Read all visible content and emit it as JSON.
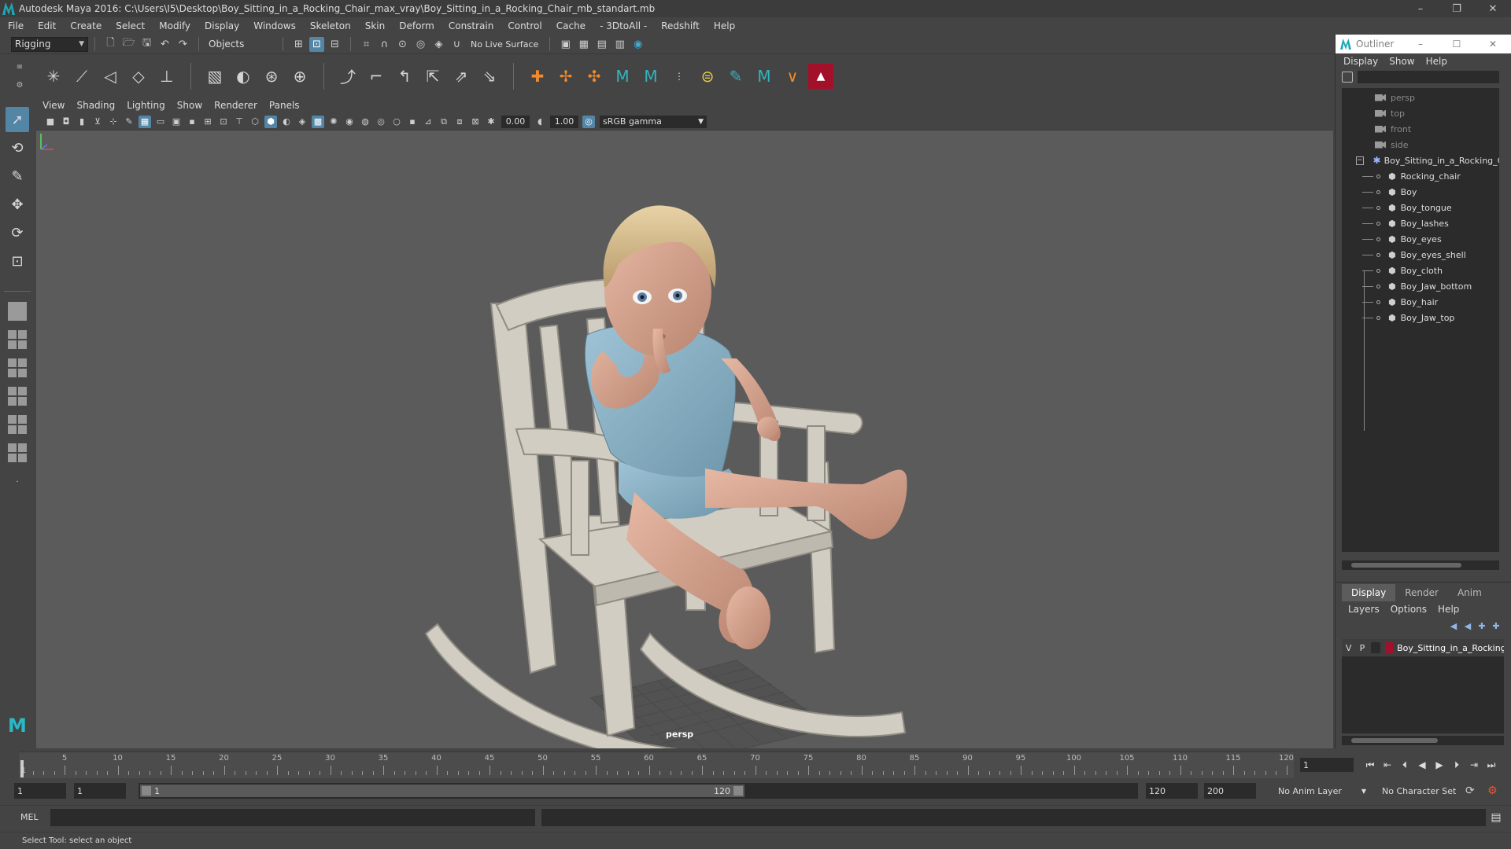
{
  "window": {
    "title": "Autodesk Maya 2016: C:\\Users\\I5\\Desktop\\Boy_Sitting_in_a_Rocking_Chair_max_vray\\Boy_Sitting_in_a_Rocking_Chair_mb_standart.mb",
    "minimize": "–",
    "maximize": "❐",
    "close": "✕"
  },
  "menubar": [
    "File",
    "Edit",
    "Create",
    "Select",
    "Modify",
    "Display",
    "Windows",
    "Skeleton",
    "Skin",
    "Deform",
    "Constrain",
    "Control",
    "Cache",
    "- 3DtoAll -",
    "Redshift",
    "Help"
  ],
  "statusline": {
    "menuset": "Rigging",
    "selection_mode": "Objects",
    "live_surface": "No Live Surface"
  },
  "panel": {
    "menus": [
      "View",
      "Shading",
      "Lighting",
      "Show",
      "Renderer",
      "Panels"
    ],
    "exposure": "0.00",
    "gamma_value": "1.00",
    "color_space": "sRGB gamma",
    "camera_label": "persp"
  },
  "outliner": {
    "title": "Outliner",
    "menus": [
      "Display",
      "Show",
      "Help"
    ],
    "cameras": [
      "persp",
      "top",
      "front",
      "side"
    ],
    "root": "Boy_Sitting_in_a_Rocking_Chair",
    "children": [
      "Rocking_chair",
      "Boy",
      "Boy_tongue",
      "Boy_lashes",
      "Boy_eyes",
      "Boy_eyes_shell",
      "Boy_cloth",
      "Boy_Jaw_bottom",
      "Boy_hair",
      "Boy_Jaw_top"
    ]
  },
  "layer_editor": {
    "tabs": [
      "Display",
      "Render",
      "Anim"
    ],
    "active_tab": "Display",
    "menus": [
      "Layers",
      "Options",
      "Help"
    ],
    "layers": [
      {
        "v": "V",
        "p": "P",
        "name": "Boy_Sitting_in_a_Rocking_Chair",
        "color": "#a2102a"
      }
    ]
  },
  "timeslider": {
    "ticks": [
      "5",
      "10",
      "15",
      "20",
      "25",
      "30",
      "35",
      "40",
      "45",
      "50",
      "55",
      "60",
      "65",
      "70",
      "75",
      "80",
      "85",
      "90",
      "95",
      "100",
      "105",
      "110",
      "115",
      "120"
    ],
    "start_marker": "1",
    "current_frame": "1",
    "max_frame": 120
  },
  "rangeslider": {
    "start": "1",
    "anim_start": "1",
    "range_start": "1",
    "range_end": "120",
    "anim_end": "120",
    "end": "200",
    "anim_layer": "No Anim Layer",
    "character_set": "No Character Set"
  },
  "command_line": {
    "label": "MEL"
  },
  "help_line": {
    "text": "Select Tool: select an object"
  },
  "colors": {
    "accent": "#5285a6",
    "maya_teal": "#1fa7b4",
    "layer_red": "#a2102a"
  }
}
